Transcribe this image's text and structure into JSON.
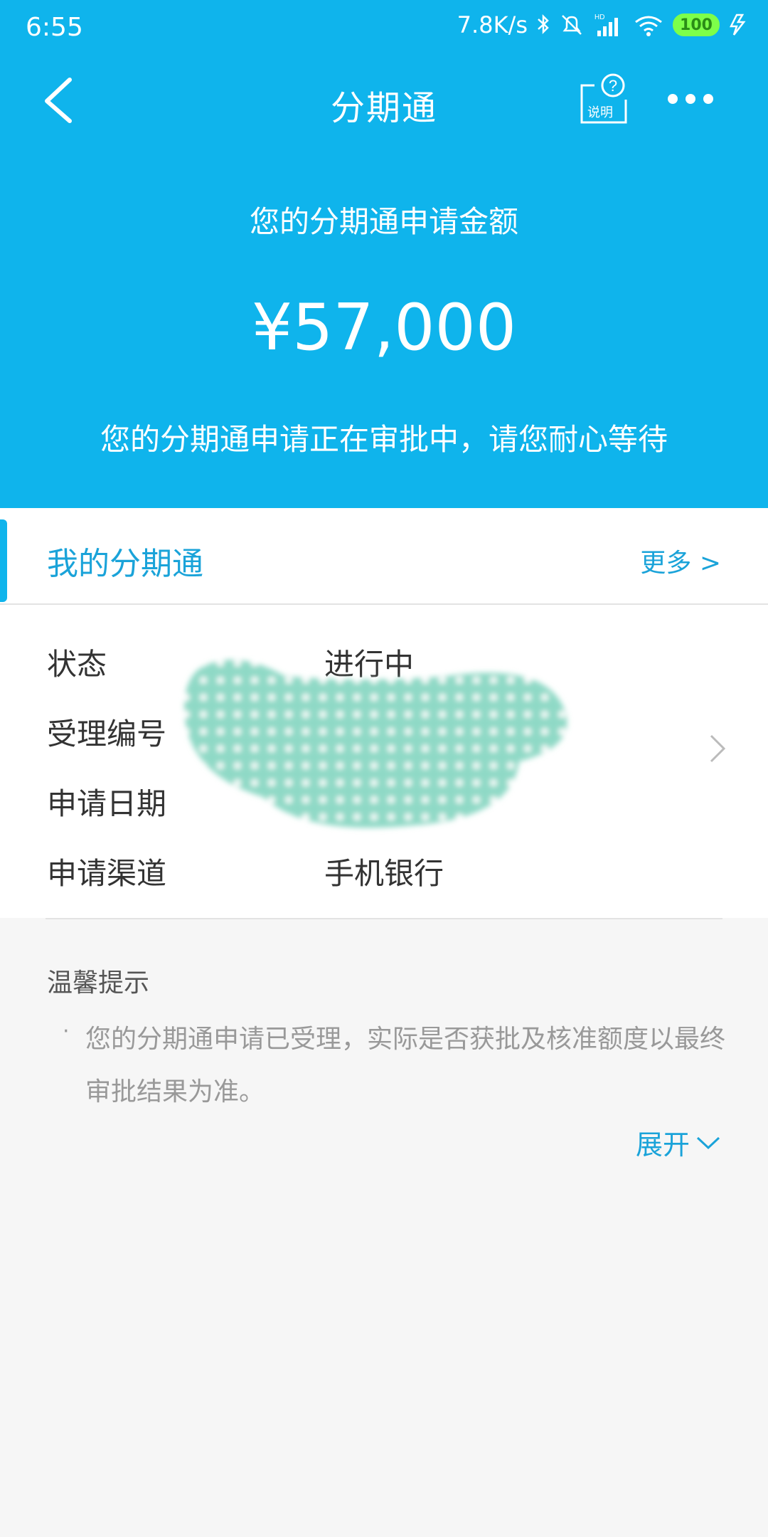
{
  "status_bar": {
    "time": "6:55",
    "net_speed": "7.8K/s",
    "battery": "100"
  },
  "nav": {
    "title": "分期通",
    "help_label": "说明"
  },
  "hero": {
    "subtitle": "您的分期通申请金额",
    "amount": "¥57,000",
    "note": "您的分期通申请正在审批中，请您耐心等待"
  },
  "card": {
    "title": "我的分期通",
    "more": "更多 >",
    "rows": [
      {
        "label": "状态",
        "value": "进行中"
      },
      {
        "label": "受理编号",
        "value": ""
      },
      {
        "label": "申请日期",
        "value": ""
      },
      {
        "label": "申请渠道",
        "value": "手机银行"
      }
    ]
  },
  "tips": {
    "title": "温馨提示",
    "bullet": "·",
    "text": "您的分期通申请已受理，实际是否获批及核准额度以最终审批结果为准。",
    "expand": "展开"
  },
  "colors": {
    "primary": "#0fb4ec",
    "link": "#1aa3d9",
    "mask": "#8fd9c6"
  }
}
